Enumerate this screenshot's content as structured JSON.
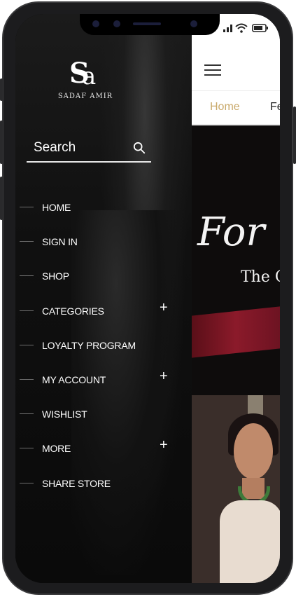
{
  "brand": {
    "logo_mark": "SA",
    "name": "SADAF AMIR"
  },
  "search": {
    "label": "Search"
  },
  "menu": {
    "items": [
      {
        "label": "HOME",
        "expandable": false
      },
      {
        "label": "SIGN IN",
        "expandable": false
      },
      {
        "label": "SHOP",
        "expandable": false
      },
      {
        "label": "CATEGORIES",
        "expandable": true
      },
      {
        "label": "LOYALTY PROGRAM",
        "expandable": false
      },
      {
        "label": "MY ACCOUNT",
        "expandable": true
      },
      {
        "label": "WISHLIST",
        "expandable": false
      },
      {
        "label": "MORE",
        "expandable": true
      },
      {
        "label": "SHARE STORE",
        "expandable": false
      }
    ],
    "expand_symbol": "+"
  },
  "app": {
    "tabs": {
      "home": "Home",
      "next": "Fe"
    },
    "banner": {
      "script_text": "For",
      "subtitle": "The C"
    }
  },
  "colors": {
    "drawer_bg": "#101010",
    "tab_active": "#c9a96a",
    "text_white": "#ffffff"
  }
}
